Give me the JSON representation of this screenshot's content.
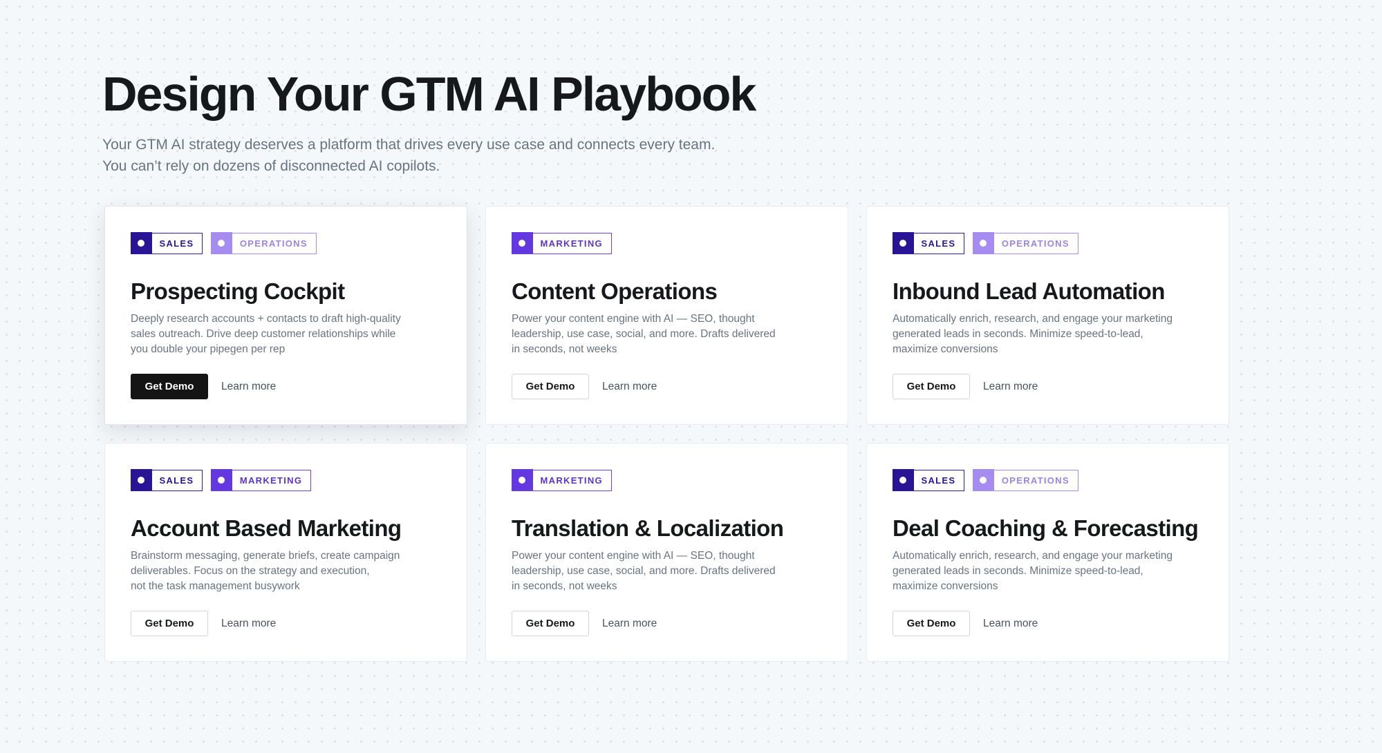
{
  "hero": {
    "title": "Design Your GTM AI Playbook",
    "subtitle_lines": [
      "Your GTM AI strategy deserves a platform that drives every use case and connects every team.",
      "You can’t rely on dozens of disconnected AI copilots."
    ]
  },
  "cards": [
    {
      "tags": [
        "SALES",
        "OPERATIONS"
      ],
      "title": "Prospecting Cockpit",
      "desc": [
        "Deeply research accounts + contacts to draft high-quality",
        "sales outreach. Drive deep customer relationships while",
        "you double your pipegen per rep"
      ],
      "demo": "Get Demo",
      "learn": "Learn more"
    },
    {
      "tags": [
        "MARKETING"
      ],
      "title": "Content Operations",
      "desc": [
        "Power your content engine with AI — SEO, thought",
        "leadership, use case, social, and more. Drafts delivered",
        "in seconds, not weeks"
      ],
      "demo": "Get Demo",
      "learn": "Learn more"
    },
    {
      "tags": [
        "SALES",
        "OPERATIONS"
      ],
      "title": "Inbound Lead Automation",
      "desc": [
        "Automatically enrich, research, and engage your marketing",
        "generated leads in seconds. Minimize speed-to-lead,",
        "maximize conversions"
      ],
      "demo": "Get Demo",
      "learn": "Learn more"
    },
    {
      "tags": [
        "SALES",
        "MARKETING"
      ],
      "title": "Account Based Marketing",
      "desc": [
        "Brainstorm messaging, generate briefs, create campaign",
        "deliverables. Focus on the strategy and execution,",
        "not the task management busywork"
      ],
      "demo": "Get Demo",
      "learn": "Learn more"
    },
    {
      "tags": [
        "MARKETING"
      ],
      "title": "Translation & Localization",
      "desc": [
        "Power your content engine with AI — SEO, thought",
        "leadership, use case, social, and more. Drafts delivered",
        "in seconds, not weeks"
      ],
      "demo": "Get Demo",
      "learn": "Learn more"
    },
    {
      "tags": [
        "SALES",
        "OPERATIONS"
      ],
      "title": "Deal Coaching & Forecasting",
      "desc": [
        "Automatically enrich, research, and engage your marketing",
        "generated leads in seconds. Minimize speed-to-lead,",
        "maximize conversions"
      ],
      "demo": "Get Demo",
      "learn": "Learn more"
    }
  ],
  "colors": {
    "sales": "#2a1496",
    "marketing": "#6338e0",
    "operations": "#a68bf0",
    "dark_button": "#141414"
  }
}
